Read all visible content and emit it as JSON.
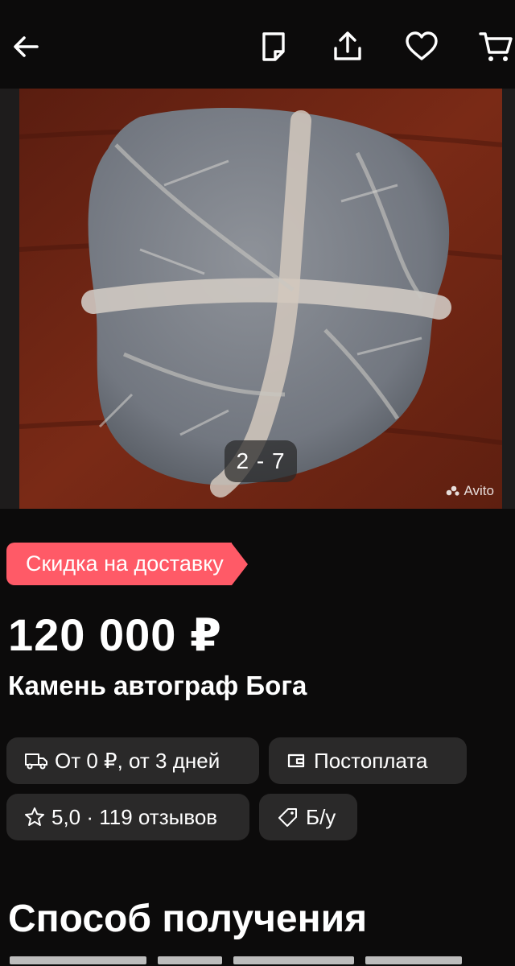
{
  "topbar": {
    "back_icon": "arrow-left-icon",
    "icons": [
      "note-icon",
      "share-icon",
      "heart-icon",
      "cart-icon"
    ]
  },
  "gallery": {
    "counter": "2 - 7",
    "watermark": "Avito"
  },
  "listing": {
    "badge": "Скидка на доставку",
    "price": "120 000 ₽",
    "title": "Камень автограф Бога"
  },
  "chips": {
    "delivery": "От 0 ₽, от 3 дней",
    "payment": "Постоплата",
    "rating": "5,0 · 119 отзывов",
    "condition": "Б/у"
  },
  "section": {
    "heading": "Способ получения"
  },
  "colors": {
    "background": "#0c0b0b",
    "chip": "#2a2929",
    "badge": "#ff5a67"
  }
}
